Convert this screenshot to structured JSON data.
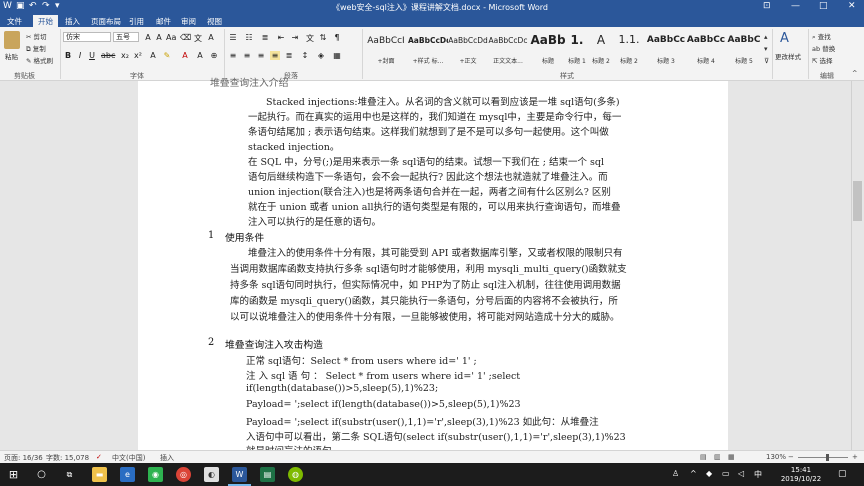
{
  "window": {
    "title": "《web安全-sql注入》课程讲解文档.docx - Microsoft Word",
    "minimize": "—",
    "maximize": "□",
    "close": "✕"
  },
  "tabs": [
    "文件",
    "开始",
    "插入",
    "页面布局",
    "引用",
    "邮件",
    "审阅",
    "视图"
  ],
  "tell_me": "♀",
  "ribbon": {
    "clipboard": {
      "paste": "粘贴",
      "cut": "剪切",
      "copy": "复制",
      "format_painter": "格式刷",
      "label": "剪贴板"
    },
    "font": {
      "name": "仿宋",
      "size": "五号",
      "label": "字体"
    },
    "paragraph": {
      "label": "段落"
    },
    "styles": {
      "label": "样式",
      "items": [
        {
          "sample": "AaBbCcI",
          "name": "+封面"
        },
        {
          "sample": "AaBbCcDd",
          "name": "+样式 标..."
        },
        {
          "sample": "AaBbCcDd",
          "name": "+正文"
        },
        {
          "sample": "AaBbCcDc",
          "name": "正文文本..."
        },
        {
          "sample": "AaBb",
          "name": "标题"
        },
        {
          "sample": "1.",
          "name": "标题 1"
        },
        {
          "sample": "A",
          "name": "标题 2"
        },
        {
          "sample": "1.1.",
          "name": "标题 2"
        },
        {
          "sample": "AaBbCc",
          "name": "标题 3"
        },
        {
          "sample": "AaBbCc",
          "name": "标题 4"
        },
        {
          "sample": "AaBbC",
          "name": "标题 5"
        }
      ]
    },
    "change_styles": "更改样式",
    "editing": {
      "find": "查找",
      "replace": "替换",
      "select": "选择",
      "label": "编辑"
    }
  },
  "document": {
    "l0": "堆叠查询注入介绍",
    "l1": "Stacked injections:堆叠注入。从名词的含义就可以看到应该是一堆 sql语句(多条)",
    "l2": "一起执行。而在真实的运用中也是这样的，我们知道在 mysql中，主要是命令行中，每一",
    "l3": "条语句结尾加 ; 表示语句结束。这样我们就想到了是不是可以多句一起使用。这个叫做",
    "l4": "stacked injection。",
    "l5": "在 SQL 中，分号(;)是用来表示一条 sql语句的结束。试想一下我们在 ; 结束一个 sql",
    "l6": "语句后继续构造下一条语句，会不会一起执行? 因此这个想法也就造就了堆叠注入。而",
    "l7": "union injection(联合注入)也是将两条语句合并在一起，两者之间有什么区别么? 区别",
    "l8": "就在于 union 或者 union all执行的语句类型是有限的，可以用来执行查询语句，而堆叠",
    "l9": "注入可以执行的是任意的语句。",
    "h1_num": "1",
    "h1": "使用条件",
    "p1": "堆叠注入的使用条件十分有限，其可能受到 API 或者数据库引擎，又或者权限的限制只有",
    "p2": "当调用数据库函数支持执行多条 sql语句时才能够使用，利用 mysqli_multi_query()函数就支",
    "p3": "持多条 sql语句同时执行，但实际情况中，如 PHP为了防止 sql注入机制，往往使用调用数据",
    "p4": "库的函数是 mysqli_query()函数，其只能执行一条语句，分号后面的内容将不会被执行，所",
    "p5": "以可以说堆叠注入的使用条件十分有限，一旦能够被使用，将可能对网站造成十分大的威胁。",
    "h2_num": "2",
    "h2": "堆叠查询注入攻击构造",
    "q1": "正常 sql语句：Select * from users where id=' 1' ;",
    "q2": "注 入 sql 语 句 ： Select * from users where id=' 1' ;select",
    "q3": "if(length(database())>5,sleep(5),1)%23;",
    "q4": "Payload=  ';select if(length(database())>5,sleep(5),1)%23",
    "q5": "Payload=  ';select if(substr(user(),1,1)='r',sleep(3),1)%23 如此句：从堆叠注",
    "q6": "入语句中可以看出，第二条 SQL语句(select if(substr(user(),1,1)='r',sleep(3),1)%23",
    "q7": "就是时间盲注的语句。"
  },
  "status": {
    "page": "页面: 16/36",
    "words": "字数: 15,078",
    "language": "中文(中国)",
    "insert": "插入",
    "zoom": "130%"
  },
  "taskbar": {
    "time": "15:41",
    "date": "2019/10/22"
  }
}
